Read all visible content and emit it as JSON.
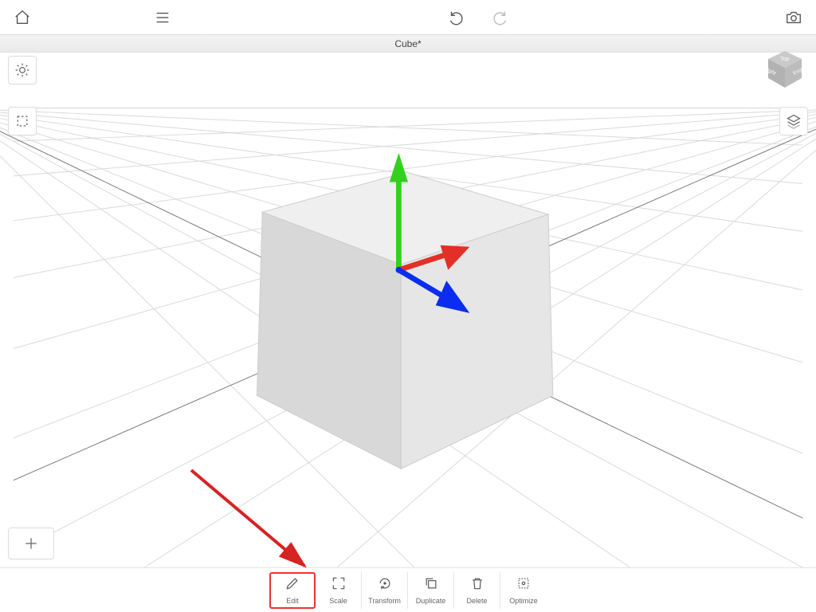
{
  "document": {
    "title": "Cube*"
  },
  "topbar": {
    "home_name": "home-icon",
    "menu_name": "menu-icon",
    "undo_name": "undo-icon",
    "redo_name": "redo-icon",
    "redo_enabled": false,
    "camera_name": "camera-icon"
  },
  "viewcube": {
    "top": "Top",
    "front": "Front",
    "right": "Right"
  },
  "left_tools": {
    "light": "light-icon",
    "select": "selection-box-icon",
    "add": "plus-icon"
  },
  "right_tools": {
    "layers": "layers-icon"
  },
  "gizmo": {
    "axes": [
      "x",
      "y",
      "z"
    ],
    "colors": {
      "x": "#e33027",
      "y": "#34d01f",
      "z": "#0a2df0"
    }
  },
  "bottom_tools": [
    {
      "id": "edit",
      "label": "Edit",
      "icon": "pencil-icon",
      "highlight": true
    },
    {
      "id": "scale",
      "label": "Scale",
      "icon": "expand-icon"
    },
    {
      "id": "transform",
      "label": "Transform",
      "icon": "rotate-icon"
    },
    {
      "id": "duplicate",
      "label": "Duplicate",
      "icon": "duplicate-icon"
    },
    {
      "id": "delete",
      "label": "Delete",
      "icon": "trash-icon"
    },
    {
      "id": "optimize",
      "label": "Optimize",
      "icon": "optimize-icon"
    }
  ],
  "annotation": {
    "type": "arrow",
    "target": "edit"
  }
}
